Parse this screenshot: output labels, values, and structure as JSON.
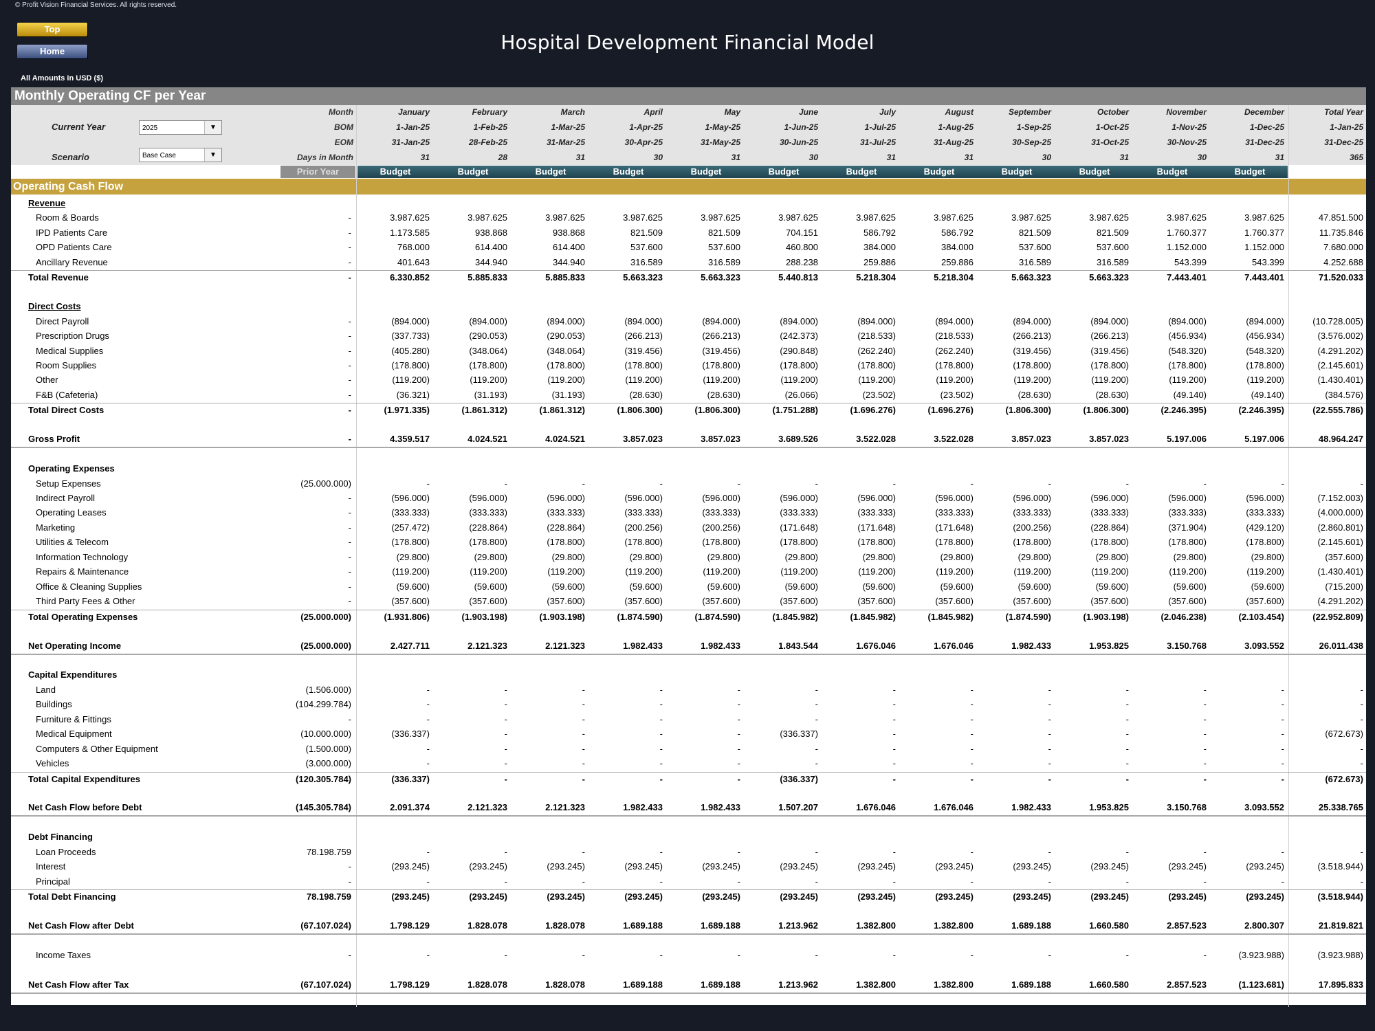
{
  "copyright": "© Profit Vision Financial Services. All rights reserved.",
  "nav": {
    "top_label": "Top",
    "home_label": "Home"
  },
  "title": "Hospital Development Financial Model",
  "amounts_note": "All Amounts in  USD ($)",
  "section_title": "Monthly Operating CF per Year",
  "controls": {
    "current_year_label": "Current Year",
    "current_year_value": "2025",
    "scenario_label": "Scenario",
    "scenario_value": "Base Case"
  },
  "header_labels": {
    "month": "Month",
    "bom": "BOM",
    "eom": "EOM",
    "days": "Days in Month"
  },
  "months": [
    "January",
    "February",
    "March",
    "April",
    "May",
    "June",
    "July",
    "August",
    "September",
    "October",
    "November",
    "December",
    "Total Year"
  ],
  "bom": [
    "1-Jan-25",
    "1-Feb-25",
    "1-Mar-25",
    "1-Apr-25",
    "1-May-25",
    "1-Jun-25",
    "1-Jul-25",
    "1-Aug-25",
    "1-Sep-25",
    "1-Oct-25",
    "1-Nov-25",
    "1-Dec-25",
    "1-Jan-25"
  ],
  "eom": [
    "31-Jan-25",
    "28-Feb-25",
    "31-Mar-25",
    "30-Apr-25",
    "31-May-25",
    "30-Jun-25",
    "31-Jul-25",
    "31-Aug-25",
    "30-Sep-25",
    "31-Oct-25",
    "30-Nov-25",
    "31-Dec-25",
    "31-Dec-25"
  ],
  "days": [
    "31",
    "28",
    "31",
    "30",
    "31",
    "30",
    "31",
    "31",
    "30",
    "31",
    "30",
    "31",
    "365"
  ],
  "prior_year_label": "Prior Year",
  "budget_label": "Budget",
  "ocf_title": "Operating Cash Flow",
  "rows": [
    {
      "type": "header-ul",
      "label": "Revenue"
    },
    {
      "type": "item",
      "label": "Room & Boards",
      "py": "-",
      "vals": [
        "3.987.625",
        "3.987.625",
        "3.987.625",
        "3.987.625",
        "3.987.625",
        "3.987.625",
        "3.987.625",
        "3.987.625",
        "3.987.625",
        "3.987.625",
        "3.987.625",
        "3.987.625",
        "47.851.500"
      ]
    },
    {
      "type": "item",
      "label": "IPD Patients Care",
      "py": "-",
      "vals": [
        "1.173.585",
        "938.868",
        "938.868",
        "821.509",
        "821.509",
        "704.151",
        "586.792",
        "586.792",
        "821.509",
        "821.509",
        "1.760.377",
        "1.760.377",
        "11.735.846"
      ]
    },
    {
      "type": "item",
      "label": "OPD Patients Care",
      "py": "-",
      "vals": [
        "768.000",
        "614.400",
        "614.400",
        "537.600",
        "537.600",
        "460.800",
        "384.000",
        "384.000",
        "537.600",
        "537.600",
        "1.152.000",
        "1.152.000",
        "7.680.000"
      ]
    },
    {
      "type": "item",
      "label": "Ancillary Revenue",
      "py": "-",
      "vals": [
        "401.643",
        "344.940",
        "344.940",
        "316.589",
        "316.589",
        "288.238",
        "259.886",
        "259.886",
        "316.589",
        "316.589",
        "543.399",
        "543.399",
        "4.252.688"
      ]
    },
    {
      "type": "total",
      "label": "Total Revenue",
      "py": "-",
      "vals": [
        "6.330.852",
        "5.885.833",
        "5.885.833",
        "5.663.323",
        "5.663.323",
        "5.440.813",
        "5.218.304",
        "5.218.304",
        "5.663.323",
        "5.663.323",
        "7.443.401",
        "7.443.401",
        "71.520.033"
      ]
    },
    {
      "type": "blank"
    },
    {
      "type": "header-ul",
      "label": "Direct Costs"
    },
    {
      "type": "item",
      "label": "Direct Payroll",
      "py": "-",
      "vals": [
        "(894.000)",
        "(894.000)",
        "(894.000)",
        "(894.000)",
        "(894.000)",
        "(894.000)",
        "(894.000)",
        "(894.000)",
        "(894.000)",
        "(894.000)",
        "(894.000)",
        "(894.000)",
        "(10.728.005)"
      ]
    },
    {
      "type": "item",
      "label": "Prescription Drugs",
      "py": "-",
      "vals": [
        "(337.733)",
        "(290.053)",
        "(290.053)",
        "(266.213)",
        "(266.213)",
        "(242.373)",
        "(218.533)",
        "(218.533)",
        "(266.213)",
        "(266.213)",
        "(456.934)",
        "(456.934)",
        "(3.576.002)"
      ]
    },
    {
      "type": "item",
      "label": "Medical Supplies",
      "py": "-",
      "vals": [
        "(405.280)",
        "(348.064)",
        "(348.064)",
        "(319.456)",
        "(319.456)",
        "(290.848)",
        "(262.240)",
        "(262.240)",
        "(319.456)",
        "(319.456)",
        "(548.320)",
        "(548.320)",
        "(4.291.202)"
      ]
    },
    {
      "type": "item",
      "label": "Room Supplies",
      "py": "-",
      "vals": [
        "(178.800)",
        "(178.800)",
        "(178.800)",
        "(178.800)",
        "(178.800)",
        "(178.800)",
        "(178.800)",
        "(178.800)",
        "(178.800)",
        "(178.800)",
        "(178.800)",
        "(178.800)",
        "(2.145.601)"
      ]
    },
    {
      "type": "item",
      "label": "Other",
      "py": "-",
      "vals": [
        "(119.200)",
        "(119.200)",
        "(119.200)",
        "(119.200)",
        "(119.200)",
        "(119.200)",
        "(119.200)",
        "(119.200)",
        "(119.200)",
        "(119.200)",
        "(119.200)",
        "(119.200)",
        "(1.430.401)"
      ]
    },
    {
      "type": "item",
      "label": "F&B (Cafeteria)",
      "py": "-",
      "vals": [
        "(36.321)",
        "(31.193)",
        "(31.193)",
        "(28.630)",
        "(28.630)",
        "(26.066)",
        "(23.502)",
        "(23.502)",
        "(28.630)",
        "(28.630)",
        "(49.140)",
        "(49.140)",
        "(384.576)"
      ]
    },
    {
      "type": "total",
      "label": "Total Direct Costs",
      "py": "-",
      "vals": [
        "(1.971.335)",
        "(1.861.312)",
        "(1.861.312)",
        "(1.806.300)",
        "(1.806.300)",
        "(1.751.288)",
        "(1.696.276)",
        "(1.696.276)",
        "(1.806.300)",
        "(1.806.300)",
        "(2.246.395)",
        "(2.246.395)",
        "(22.555.786)"
      ]
    },
    {
      "type": "blank"
    },
    {
      "type": "net",
      "label": "Gross Profit",
      "py": "-",
      "vals": [
        "4.359.517",
        "4.024.521",
        "4.024.521",
        "3.857.023",
        "3.857.023",
        "3.689.526",
        "3.522.028",
        "3.522.028",
        "3.857.023",
        "3.857.023",
        "5.197.006",
        "5.197.006",
        "48.964.247"
      ]
    },
    {
      "type": "blank"
    },
    {
      "type": "header",
      "label": "Operating Expenses"
    },
    {
      "type": "item",
      "label": "Setup Expenses",
      "py": "(25.000.000)",
      "vals": [
        "-",
        "-",
        "-",
        "-",
        "-",
        "-",
        "-",
        "-",
        "-",
        "-",
        "-",
        "-",
        "-"
      ]
    },
    {
      "type": "item",
      "label": "Indirect Payroll",
      "py": "-",
      "vals": [
        "(596.000)",
        "(596.000)",
        "(596.000)",
        "(596.000)",
        "(596.000)",
        "(596.000)",
        "(596.000)",
        "(596.000)",
        "(596.000)",
        "(596.000)",
        "(596.000)",
        "(596.000)",
        "(7.152.003)"
      ]
    },
    {
      "type": "item",
      "label": "Operating Leases",
      "py": "-",
      "vals": [
        "(333.333)",
        "(333.333)",
        "(333.333)",
        "(333.333)",
        "(333.333)",
        "(333.333)",
        "(333.333)",
        "(333.333)",
        "(333.333)",
        "(333.333)",
        "(333.333)",
        "(333.333)",
        "(4.000.000)"
      ]
    },
    {
      "type": "item",
      "label": "Marketing",
      "py": "-",
      "vals": [
        "(257.472)",
        "(228.864)",
        "(228.864)",
        "(200.256)",
        "(200.256)",
        "(171.648)",
        "(171.648)",
        "(171.648)",
        "(200.256)",
        "(228.864)",
        "(371.904)",
        "(429.120)",
        "(2.860.801)"
      ]
    },
    {
      "type": "item",
      "label": "Utilities & Telecom",
      "py": "-",
      "vals": [
        "(178.800)",
        "(178.800)",
        "(178.800)",
        "(178.800)",
        "(178.800)",
        "(178.800)",
        "(178.800)",
        "(178.800)",
        "(178.800)",
        "(178.800)",
        "(178.800)",
        "(178.800)",
        "(2.145.601)"
      ]
    },
    {
      "type": "item",
      "label": "Information Technology",
      "py": "-",
      "vals": [
        "(29.800)",
        "(29.800)",
        "(29.800)",
        "(29.800)",
        "(29.800)",
        "(29.800)",
        "(29.800)",
        "(29.800)",
        "(29.800)",
        "(29.800)",
        "(29.800)",
        "(29.800)",
        "(357.600)"
      ]
    },
    {
      "type": "item",
      "label": "Repairs & Maintenance",
      "py": "-",
      "vals": [
        "(119.200)",
        "(119.200)",
        "(119.200)",
        "(119.200)",
        "(119.200)",
        "(119.200)",
        "(119.200)",
        "(119.200)",
        "(119.200)",
        "(119.200)",
        "(119.200)",
        "(119.200)",
        "(1.430.401)"
      ]
    },
    {
      "type": "item",
      "label": "Office & Cleaning Supplies",
      "py": "-",
      "vals": [
        "(59.600)",
        "(59.600)",
        "(59.600)",
        "(59.600)",
        "(59.600)",
        "(59.600)",
        "(59.600)",
        "(59.600)",
        "(59.600)",
        "(59.600)",
        "(59.600)",
        "(59.600)",
        "(715.200)"
      ]
    },
    {
      "type": "item",
      "label": "Third Party Fees & Other",
      "py": "-",
      "vals": [
        "(357.600)",
        "(357.600)",
        "(357.600)",
        "(357.600)",
        "(357.600)",
        "(357.600)",
        "(357.600)",
        "(357.600)",
        "(357.600)",
        "(357.600)",
        "(357.600)",
        "(357.600)",
        "(4.291.202)"
      ]
    },
    {
      "type": "total",
      "label": "Total Operating Expenses",
      "py": "(25.000.000)",
      "vals": [
        "(1.931.806)",
        "(1.903.198)",
        "(1.903.198)",
        "(1.874.590)",
        "(1.874.590)",
        "(1.845.982)",
        "(1.845.982)",
        "(1.845.982)",
        "(1.874.590)",
        "(1.903.198)",
        "(2.046.238)",
        "(2.103.454)",
        "(22.952.809)"
      ]
    },
    {
      "type": "blank"
    },
    {
      "type": "net",
      "label": "Net Operating Income",
      "py": "(25.000.000)",
      "vals": [
        "2.427.711",
        "2.121.323",
        "2.121.323",
        "1.982.433",
        "1.982.433",
        "1.843.544",
        "1.676.046",
        "1.676.046",
        "1.982.433",
        "1.953.825",
        "3.150.768",
        "3.093.552",
        "26.011.438"
      ]
    },
    {
      "type": "blank"
    },
    {
      "type": "header",
      "label": "Capital Expenditures"
    },
    {
      "type": "item",
      "label": "Land",
      "py": "(1.506.000)",
      "vals": [
        "-",
        "-",
        "-",
        "-",
        "-",
        "-",
        "-",
        "-",
        "-",
        "-",
        "-",
        "-",
        "-"
      ]
    },
    {
      "type": "item",
      "label": "Buildings",
      "py": "(104.299.784)",
      "vals": [
        "-",
        "-",
        "-",
        "-",
        "-",
        "-",
        "-",
        "-",
        "-",
        "-",
        "-",
        "-",
        "-"
      ]
    },
    {
      "type": "item",
      "label": "Furniture & Fittings",
      "py": "-",
      "vals": [
        "-",
        "-",
        "-",
        "-",
        "-",
        "-",
        "-",
        "-",
        "-",
        "-",
        "-",
        "-",
        "-"
      ]
    },
    {
      "type": "item",
      "label": "Medical Equipment",
      "py": "(10.000.000)",
      "vals": [
        "(336.337)",
        "-",
        "-",
        "-",
        "-",
        "(336.337)",
        "-",
        "-",
        "-",
        "-",
        "-",
        "-",
        "(672.673)"
      ]
    },
    {
      "type": "item",
      "label": "Computers & Other Equipment",
      "py": "(1.500.000)",
      "vals": [
        "-",
        "-",
        "-",
        "-",
        "-",
        "-",
        "-",
        "-",
        "-",
        "-",
        "-",
        "-",
        "-"
      ]
    },
    {
      "type": "item",
      "label": "Vehicles",
      "py": "(3.000.000)",
      "vals": [
        "-",
        "-",
        "-",
        "-",
        "-",
        "-",
        "-",
        "-",
        "-",
        "-",
        "-",
        "-",
        "-"
      ]
    },
    {
      "type": "total",
      "label": "Total Capital Expenditures",
      "py": "(120.305.784)",
      "vals": [
        "(336.337)",
        "-",
        "-",
        "-",
        "-",
        "(336.337)",
        "-",
        "-",
        "-",
        "-",
        "-",
        "-",
        "(672.673)"
      ]
    },
    {
      "type": "blank"
    },
    {
      "type": "net",
      "label": "Net Cash Flow before Debt",
      "py": "(145.305.784)",
      "vals": [
        "2.091.374",
        "2.121.323",
        "2.121.323",
        "1.982.433",
        "1.982.433",
        "1.507.207",
        "1.676.046",
        "1.676.046",
        "1.982.433",
        "1.953.825",
        "3.150.768",
        "3.093.552",
        "25.338.765"
      ]
    },
    {
      "type": "blank"
    },
    {
      "type": "header",
      "label": "Debt Financing"
    },
    {
      "type": "item",
      "label": "Loan Proceeds",
      "py": "78.198.759",
      "vals": [
        "-",
        "-",
        "-",
        "-",
        "-",
        "-",
        "-",
        "-",
        "-",
        "-",
        "-",
        "-",
        "-"
      ]
    },
    {
      "type": "item",
      "label": "Interest",
      "py": "-",
      "vals": [
        "(293.245)",
        "(293.245)",
        "(293.245)",
        "(293.245)",
        "(293.245)",
        "(293.245)",
        "(293.245)",
        "(293.245)",
        "(293.245)",
        "(293.245)",
        "(293.245)",
        "(293.245)",
        "(3.518.944)"
      ]
    },
    {
      "type": "item",
      "label": "Principal",
      "py": "-",
      "vals": [
        "-",
        "-",
        "-",
        "-",
        "-",
        "-",
        "-",
        "-",
        "-",
        "-",
        "-",
        "-",
        "-"
      ]
    },
    {
      "type": "total",
      "label": "Total Debt Financing",
      "py": "78.198.759",
      "vals": [
        "(293.245)",
        "(293.245)",
        "(293.245)",
        "(293.245)",
        "(293.245)",
        "(293.245)",
        "(293.245)",
        "(293.245)",
        "(293.245)",
        "(293.245)",
        "(293.245)",
        "(293.245)",
        "(3.518.944)"
      ]
    },
    {
      "type": "blank"
    },
    {
      "type": "net",
      "label": "Net Cash Flow after Debt",
      "py": "(67.107.024)",
      "vals": [
        "1.798.129",
        "1.828.078",
        "1.828.078",
        "1.689.188",
        "1.689.188",
        "1.213.962",
        "1.382.800",
        "1.382.800",
        "1.689.188",
        "1.660.580",
        "2.857.523",
        "2.800.307",
        "21.819.821"
      ]
    },
    {
      "type": "blank"
    },
    {
      "type": "item",
      "label": "Income Taxes",
      "py": "-",
      "vals": [
        "-",
        "-",
        "-",
        "-",
        "-",
        "-",
        "-",
        "-",
        "-",
        "-",
        "-",
        "(3.923.988)",
        "(3.923.988)"
      ]
    },
    {
      "type": "blank"
    },
    {
      "type": "net",
      "label": "Net Cash Flow after Tax",
      "py": "(67.107.024)",
      "vals": [
        "1.798.129",
        "1.828.078",
        "1.828.078",
        "1.689.188",
        "1.689.188",
        "1.213.962",
        "1.382.800",
        "1.382.800",
        "1.689.188",
        "1.660.580",
        "2.857.523",
        "(1.123.681)",
        "17.895.833"
      ]
    }
  ]
}
